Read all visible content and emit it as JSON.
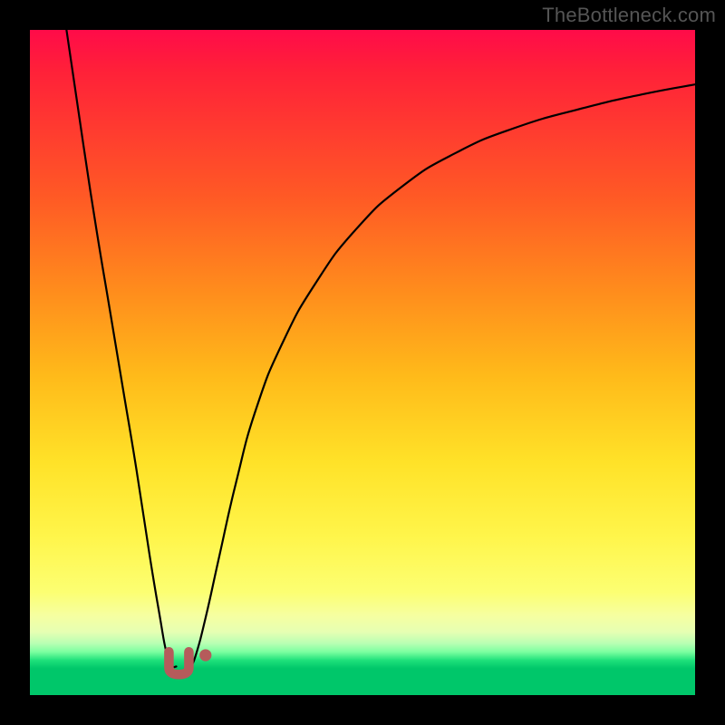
{
  "watermark": {
    "text": "TheBottleneck.com"
  },
  "chart_data": {
    "type": "line",
    "title": "",
    "xlabel": "",
    "ylabel": "",
    "xlim": [
      0,
      100
    ],
    "ylim": [
      0,
      100
    ],
    "grid": false,
    "legend": false,
    "series": [
      {
        "name": "left-branch",
        "x": [
          5.5,
          8,
          10,
          12,
          14,
          16,
          18,
          19.5,
          20.5,
          21.3,
          22.0
        ],
        "values": [
          100,
          83,
          70,
          58,
          46,
          34,
          21,
          12,
          6.5,
          4.5,
          4.3
        ]
      },
      {
        "name": "right-branch",
        "x": [
          24.2,
          25.0,
          26.5,
          28.5,
          31,
          34,
          38,
          43,
          49,
          56,
          64,
          73,
          83,
          92,
          100
        ],
        "values": [
          4.3,
          6.2,
          12,
          21,
          32,
          43,
          53,
          62,
          70,
          76.5,
          81.5,
          85.3,
          88.2,
          90.3,
          91.8
        ]
      }
    ],
    "markers": [
      {
        "shape": "u-blob",
        "cx": 22.4,
        "cy": 4.8,
        "w": 3.0,
        "h": 3.4,
        "color": "#b55b5b"
      },
      {
        "shape": "dot",
        "cx": 26.4,
        "cy": 6.0,
        "r": 0.9,
        "color": "#b55b5b"
      }
    ],
    "colors": {
      "curve": "#000000",
      "marker": "#b55b5b",
      "gradient_top": "#ff0b49",
      "gradient_bottom": "#00c76a"
    }
  }
}
